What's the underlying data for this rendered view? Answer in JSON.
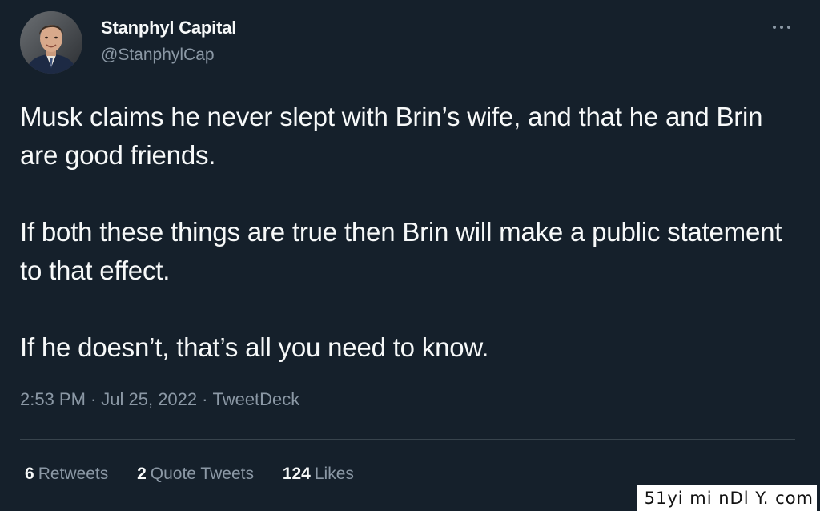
{
  "author": {
    "name": "Stanphyl Capital",
    "handle": "@StanphylCap"
  },
  "tweet": {
    "paragraphs": [
      "Musk claims he never slept with Brin’s wife, and that he and Brin are good friends.",
      "If both these things are true then Brin will make a public statement to that effect.",
      "If he doesn’t, that’s all you need to know."
    ]
  },
  "meta": {
    "time": "2:53 PM",
    "separator": "·",
    "date": "Jul 25, 2022",
    "source": "TweetDeck"
  },
  "stats": {
    "retweets_count": "6",
    "retweets_label": "Retweets",
    "quotes_count": "2",
    "quotes_label": "Quote Tweets",
    "likes_count": "124",
    "likes_label": "Likes"
  },
  "icons": {
    "more": "more-horizontal-icon",
    "avatar": "profile-photo"
  },
  "colors": {
    "background": "#15202b",
    "text_primary": "#f7f9f9",
    "text_secondary": "#8b98a5",
    "divider": "#38444d"
  },
  "watermark": "51yi mi nDl Y. com"
}
